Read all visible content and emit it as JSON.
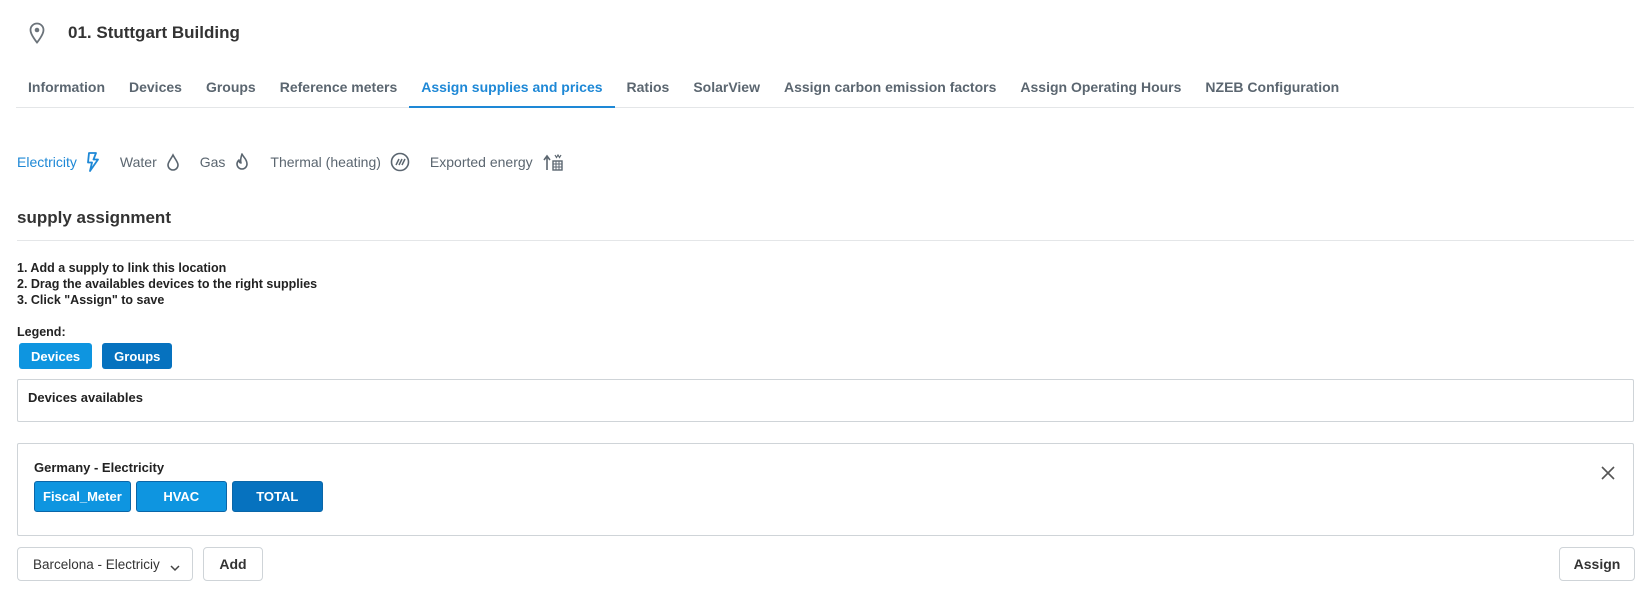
{
  "location": {
    "title": "01. Stuttgart Building",
    "icon": "map-pin-icon"
  },
  "tabs": [
    {
      "label": "Information",
      "active": false
    },
    {
      "label": "Devices",
      "active": false
    },
    {
      "label": "Groups",
      "active": false
    },
    {
      "label": "Reference meters",
      "active": false
    },
    {
      "label": "Assign supplies and prices",
      "active": true
    },
    {
      "label": "Ratios",
      "active": false
    },
    {
      "label": "SolarView",
      "active": false
    },
    {
      "label": "Assign carbon emission factors",
      "active": false
    },
    {
      "label": "Assign Operating Hours",
      "active": false
    },
    {
      "label": "NZEB Configuration",
      "active": false
    }
  ],
  "energy_tabs": [
    {
      "label": "Electricity",
      "icon": "lightning-icon",
      "active": true
    },
    {
      "label": "Water",
      "icon": "water-drop-icon",
      "active": false
    },
    {
      "label": "Gas",
      "icon": "flame-icon",
      "active": false
    },
    {
      "label": "Thermal (heating)",
      "icon": "heating-icon",
      "active": false
    },
    {
      "label": "Exported energy",
      "icon": "exported-energy-icon",
      "active": false
    }
  ],
  "section": {
    "title": "supply assignment",
    "steps": [
      "1. Add a supply to link this location",
      "2. Drag the availables devices to the right supplies",
      "3. Click \"Assign\" to save"
    ]
  },
  "legend": {
    "label": "Legend:",
    "devices": "Devices",
    "groups": "Groups",
    "colors": {
      "devices": "#0e95e0",
      "groups": "#0672bf"
    }
  },
  "available": {
    "title": "Devices availables"
  },
  "supply": {
    "title": "Germany - Electricity",
    "items": [
      {
        "label": "Fiscal_Meter",
        "kind": "device"
      },
      {
        "label": "HVAC",
        "kind": "device"
      },
      {
        "label": "TOTAL",
        "kind": "group"
      }
    ]
  },
  "footer": {
    "select_value": "Barcelona - Electriciy",
    "add_label": "Add",
    "assign_label": "Assign"
  },
  "colors": {
    "accent": "#1e88d6",
    "text_muted": "#5b6670"
  }
}
